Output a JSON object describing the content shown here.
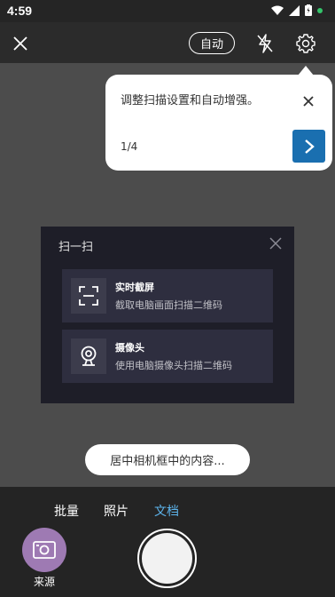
{
  "status_bar": {
    "time": "4:59"
  },
  "top_bar": {
    "auto_label": "自动"
  },
  "tooltip": {
    "text": "调整扫描设置和自动增强。",
    "page": "1/4"
  },
  "scan_panel": {
    "title": "扫一扫",
    "items": [
      {
        "title": "实时截屏",
        "subtitle": "截取电脑画面扫描二维码",
        "icon": "screen-capture-icon"
      },
      {
        "title": "摄像头",
        "subtitle": "使用电脑摄像头扫描二维码",
        "icon": "webcam-icon"
      }
    ]
  },
  "hint": {
    "text": "居中相机框中的内容..."
  },
  "modes": {
    "batch": "批量",
    "photo": "照片",
    "document": "文档",
    "active": "文档"
  },
  "source": {
    "label": "来源"
  },
  "colors": {
    "accent": "#1a6fb0",
    "active_mode": "#5db4ec",
    "source_button": "#9e7ab3"
  }
}
